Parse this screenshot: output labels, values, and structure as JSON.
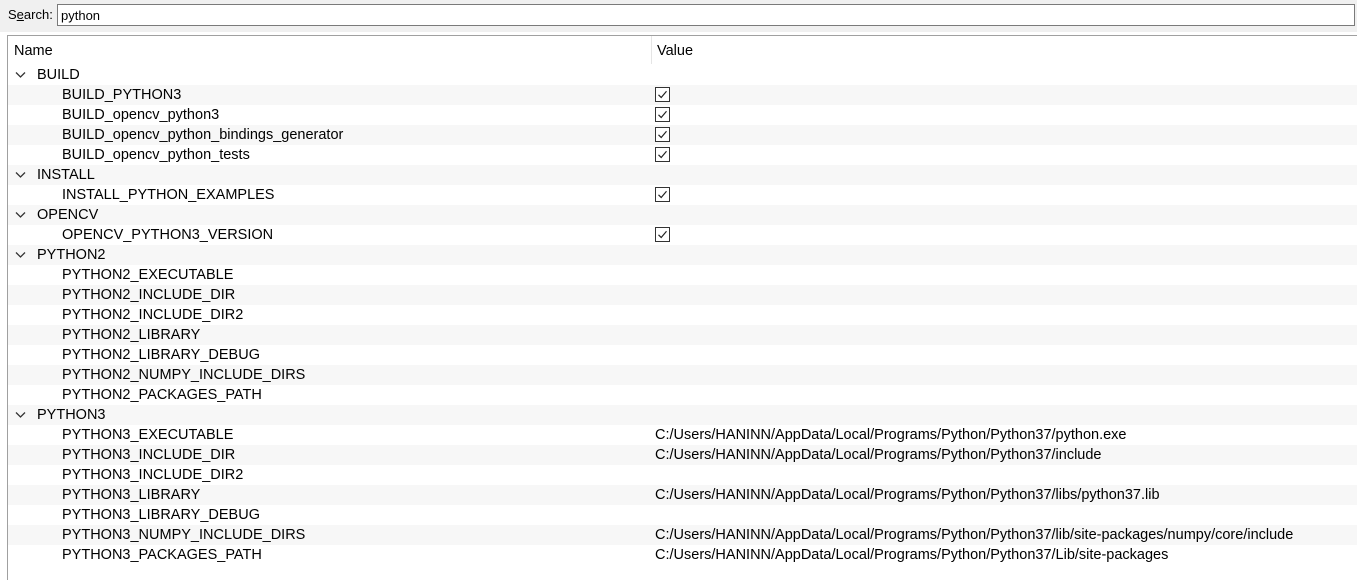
{
  "search": {
    "label_prefix": "S",
    "label_underlined": "e",
    "label_suffix": "arch:",
    "value": "python"
  },
  "columns": {
    "name": "Name",
    "value": "Value"
  },
  "rows": [
    {
      "type": "group",
      "label": "BUILD",
      "expanded": true
    },
    {
      "type": "item",
      "name": "BUILD_PYTHON3",
      "checkbox": true,
      "checked": true
    },
    {
      "type": "item",
      "name": "BUILD_opencv_python3",
      "checkbox": true,
      "checked": true
    },
    {
      "type": "item",
      "name": "BUILD_opencv_python_bindings_generator",
      "checkbox": true,
      "checked": true
    },
    {
      "type": "item",
      "name": "BUILD_opencv_python_tests",
      "checkbox": true,
      "checked": true
    },
    {
      "type": "group",
      "label": "INSTALL",
      "expanded": true
    },
    {
      "type": "item",
      "name": "INSTALL_PYTHON_EXAMPLES",
      "checkbox": true,
      "checked": true
    },
    {
      "type": "group",
      "label": "OPENCV",
      "expanded": true
    },
    {
      "type": "item",
      "name": "OPENCV_PYTHON3_VERSION",
      "checkbox": true,
      "checked": true
    },
    {
      "type": "group",
      "label": "PYTHON2",
      "expanded": true
    },
    {
      "type": "item",
      "name": "PYTHON2_EXECUTABLE",
      "value": ""
    },
    {
      "type": "item",
      "name": "PYTHON2_INCLUDE_DIR",
      "value": ""
    },
    {
      "type": "item",
      "name": "PYTHON2_INCLUDE_DIR2",
      "value": ""
    },
    {
      "type": "item",
      "name": "PYTHON2_LIBRARY",
      "value": ""
    },
    {
      "type": "item",
      "name": "PYTHON2_LIBRARY_DEBUG",
      "value": ""
    },
    {
      "type": "item",
      "name": "PYTHON2_NUMPY_INCLUDE_DIRS",
      "value": ""
    },
    {
      "type": "item",
      "name": "PYTHON2_PACKAGES_PATH",
      "value": ""
    },
    {
      "type": "group",
      "label": "PYTHON3",
      "expanded": true
    },
    {
      "type": "item",
      "name": "PYTHON3_EXECUTABLE",
      "value": "C:/Users/HANINN/AppData/Local/Programs/Python/Python37/python.exe"
    },
    {
      "type": "item",
      "name": "PYTHON3_INCLUDE_DIR",
      "value": "C:/Users/HANINN/AppData/Local/Programs/Python/Python37/include"
    },
    {
      "type": "item",
      "name": "PYTHON3_INCLUDE_DIR2",
      "value": ""
    },
    {
      "type": "item",
      "name": "PYTHON3_LIBRARY",
      "value": "C:/Users/HANINN/AppData/Local/Programs/Python/Python37/libs/python37.lib"
    },
    {
      "type": "item",
      "name": "PYTHON3_LIBRARY_DEBUG",
      "value": ""
    },
    {
      "type": "item",
      "name": "PYTHON3_NUMPY_INCLUDE_DIRS",
      "value": "C:/Users/HANINN/AppData/Local/Programs/Python/Python37/lib/site-packages/numpy/core/include"
    },
    {
      "type": "item",
      "name": "PYTHON3_PACKAGES_PATH",
      "value": "C:/Users/HANINN/AppData/Local/Programs/Python/Python37/Lib/site-packages"
    }
  ],
  "icons": {
    "expanded": "chevron-down-icon",
    "checked": "checkbox-checked-icon"
  },
  "colors": {
    "alt_row": "#f7f7f7",
    "toolbar": "#f0f0f0",
    "border": "#a0a0a0"
  }
}
